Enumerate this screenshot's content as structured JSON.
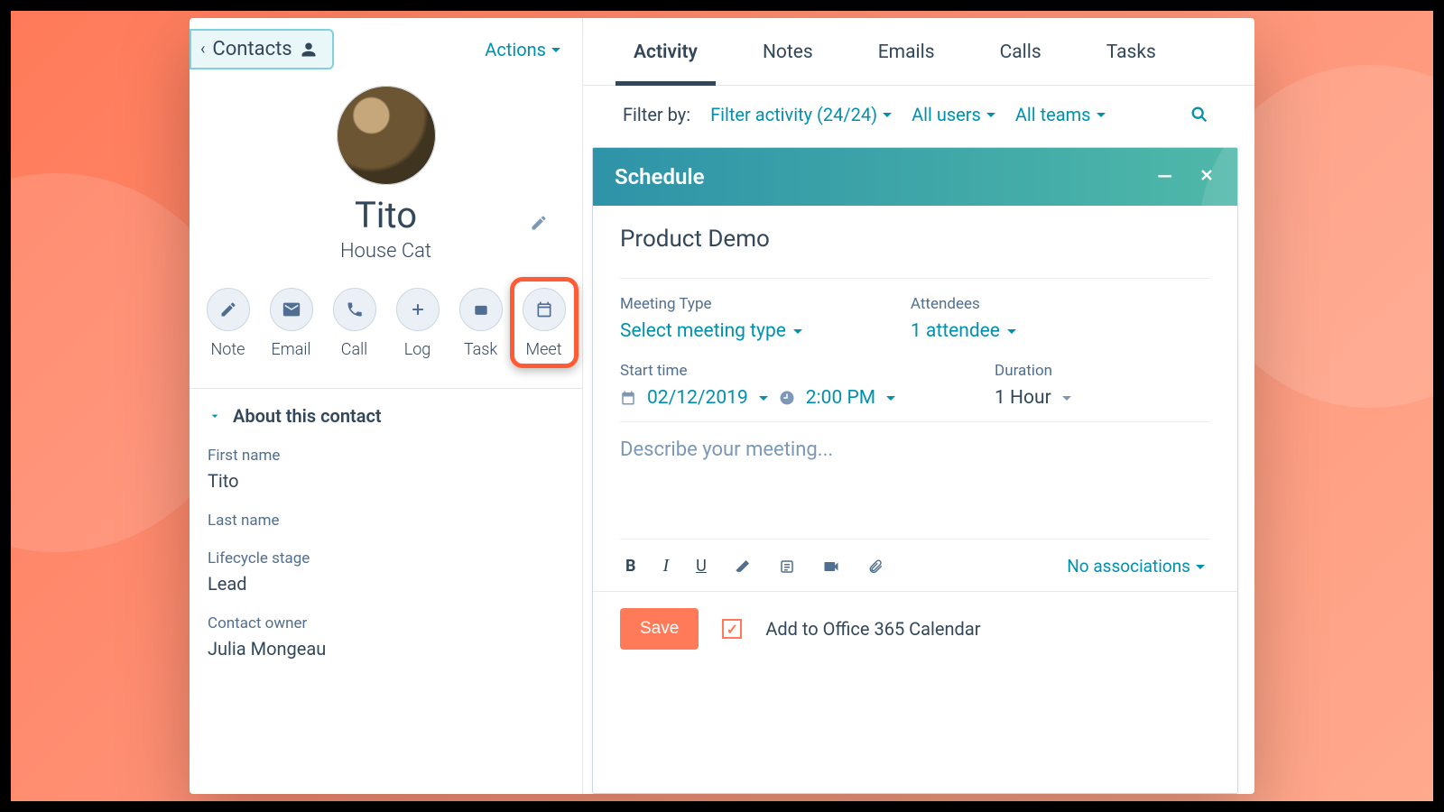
{
  "header": {
    "back_label": "Contacts",
    "actions_label": "Actions"
  },
  "contact": {
    "name": "Tito",
    "subtitle": "House Cat"
  },
  "action_buttons": {
    "note": "Note",
    "email": "Email",
    "call": "Call",
    "log": "Log",
    "task": "Task",
    "meet": "Meet"
  },
  "about": {
    "heading": "About this contact",
    "first_name_label": "First name",
    "first_name_value": "Tito",
    "last_name_label": "Last name",
    "last_name_value": "",
    "lifecycle_label": "Lifecycle stage",
    "lifecycle_value": "Lead",
    "owner_label": "Contact owner",
    "owner_value": "Julia Mongeau"
  },
  "tabs": {
    "activity": "Activity",
    "notes": "Notes",
    "emails": "Emails",
    "calls": "Calls",
    "tasks": "Tasks"
  },
  "filters": {
    "prefix": "Filter by:",
    "activity": "Filter activity (24/24)",
    "users": "All users",
    "teams": "All teams"
  },
  "schedule": {
    "panel_title": "Schedule",
    "title": "Product Demo",
    "meeting_type_label": "Meeting Type",
    "meeting_type_value": "Select meeting type",
    "attendees_label": "Attendees",
    "attendees_value": "1 attendee",
    "start_label": "Start time",
    "start_date": "02/12/2019",
    "start_time": "2:00 PM",
    "duration_label": "Duration",
    "duration_value": "1 Hour",
    "desc_placeholder": "Describe your meeting...",
    "associations": "No associations",
    "save": "Save",
    "calendar_label": "Add to Office 365 Calendar"
  }
}
